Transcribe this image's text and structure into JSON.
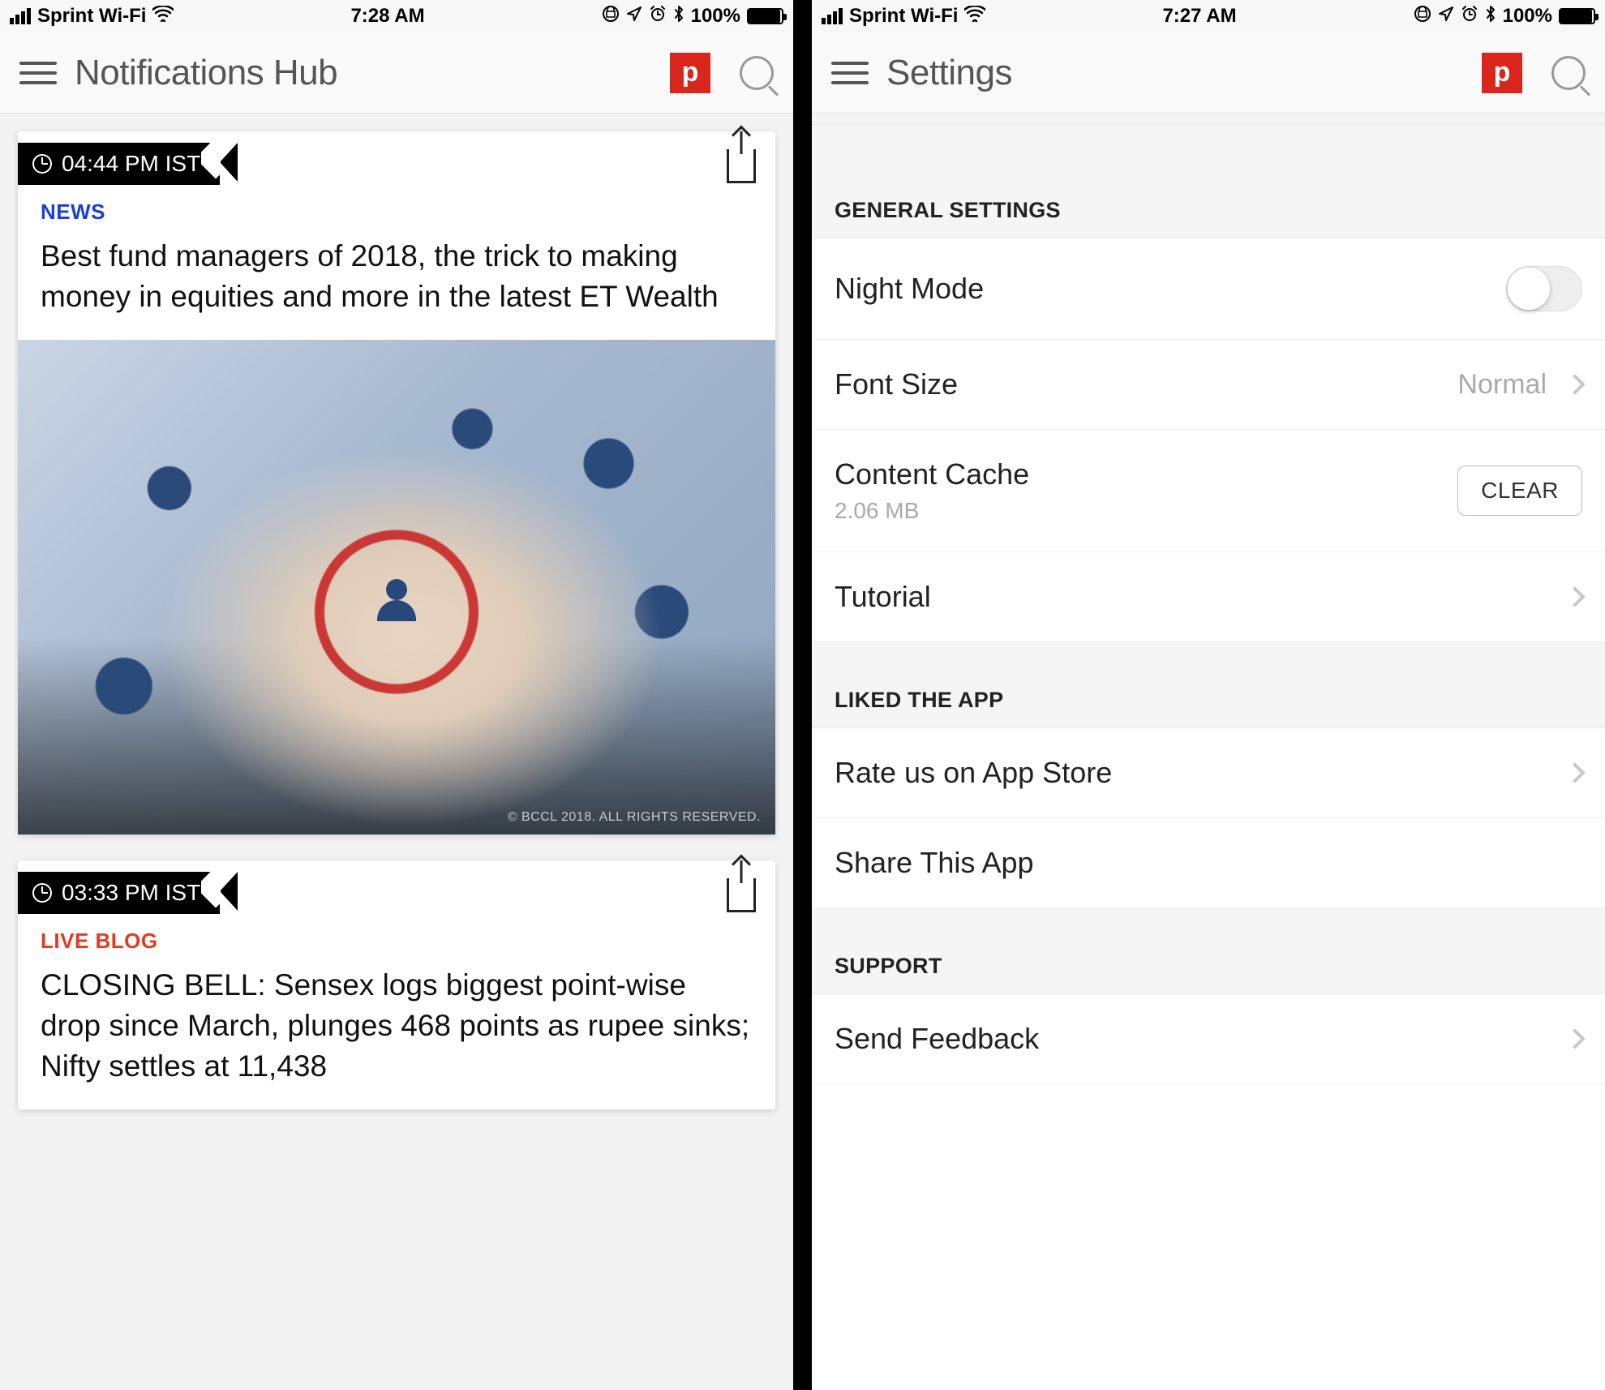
{
  "left": {
    "status": {
      "carrier": "Sprint Wi-Fi",
      "time": "7:28 AM",
      "battery_pct": "100%"
    },
    "nav": {
      "title": "Notifications Hub",
      "logo_letter": "p"
    },
    "cards": [
      {
        "time": "04:44 PM IST",
        "category": "NEWS",
        "category_class": "cat-news",
        "headline": "Best fund managers of 2018, the trick to making money in equities and more in the latest ET Wealth",
        "image_caption": "© BCCL 2018. ALL RIGHTS RESERVED.",
        "has_image": true
      },
      {
        "time": "03:33 PM IST",
        "category": "LIVE BLOG",
        "category_class": "cat-live",
        "headline": "CLOSING BELL: Sensex logs biggest point-wise drop since March, plunges 468 points as rupee sinks; Nifty settles at 11,438",
        "has_image": false
      }
    ]
  },
  "right": {
    "status": {
      "carrier": "Sprint Wi-Fi",
      "time": "7:27 AM",
      "battery_pct": "100%"
    },
    "nav": {
      "title": "Settings",
      "logo_letter": "p"
    },
    "sections": {
      "general_header": "GENERAL SETTINGS",
      "night_mode": "Night Mode",
      "font_size_label": "Font Size",
      "font_size_value": "Normal",
      "cache_label": "Content Cache",
      "cache_value": "2.06 MB",
      "cache_button": "CLEAR",
      "tutorial": "Tutorial",
      "liked_header": "LIKED THE APP",
      "rate": "Rate us on App Store",
      "share": "Share This App",
      "support_header": "SUPPORT",
      "feedback": "Send Feedback"
    }
  }
}
